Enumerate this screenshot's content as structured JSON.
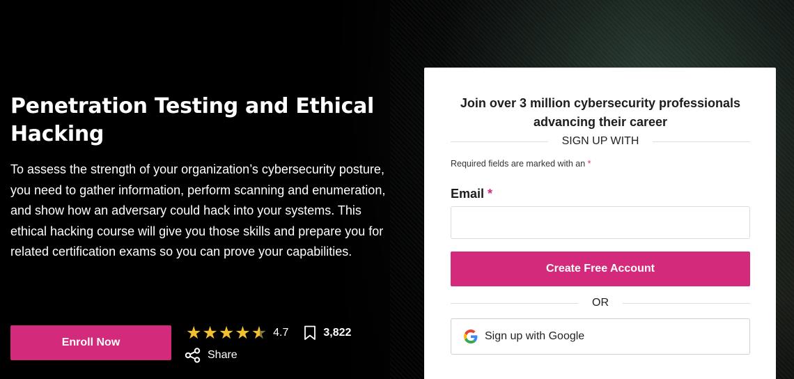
{
  "hero": {
    "title": "Penetration Testing and Ethical Hacking",
    "description": "To assess the strength of your organization’s cybersecurity posture, you need to gather information, perform scanning and enumeration, and show how an adversary could hack into your systems. This ethical hacking course will give you those skills and prepare you for related certification exams so you can prove your capabilities.",
    "enroll_label": "Enroll Now",
    "rating": {
      "value": "4.7",
      "stars": 4.7,
      "icon": "star-icon",
      "color": "#f2c02f"
    },
    "bookmark": {
      "icon": "bookmark-icon",
      "count": "3,822"
    },
    "share": {
      "icon": "share-icon",
      "label": "Share"
    }
  },
  "signup": {
    "heading": "Join over 3 million cybersecurity professionals advancing their career",
    "sign_up_with": "SIGN UP WITH",
    "required_note": "Required fields are marked with an",
    "asterisk": "*",
    "email_label": "Email",
    "email_value": "",
    "email_placeholder": "",
    "create_label": "Create Free Account",
    "or_label": "OR",
    "google_label": "Sign up with Google",
    "google_icon": "google-icon"
  },
  "colors": {
    "accent": "#d32a7b",
    "star": "#f2c02f",
    "background": "#000000",
    "card": "#ffffff"
  }
}
